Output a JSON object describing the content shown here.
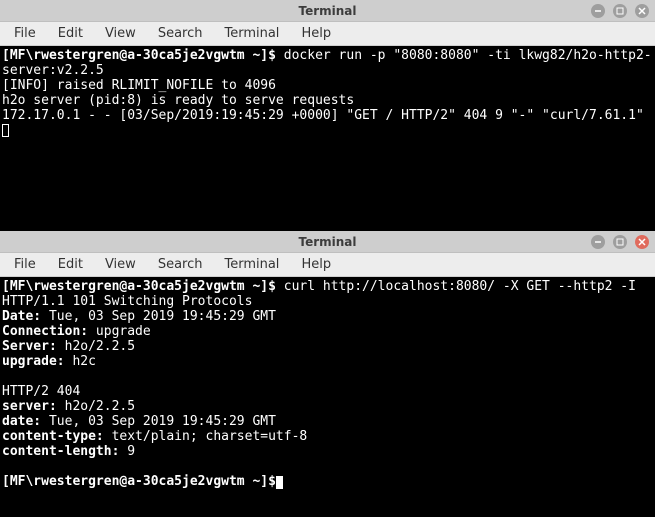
{
  "window1": {
    "title": "Terminal",
    "menu": [
      "File",
      "Edit",
      "View",
      "Search",
      "Terminal",
      "Help"
    ],
    "prompt": "[MF\\rwestergren@a-30ca5je2vgwtm ~]$",
    "cmd": " docker run -p \"8080:8080\" -ti lkwg82/h2o-http2-server:v2.2.5",
    "lines": [
      "[INFO] raised RLIMIT_NOFILE to 4096",
      "h2o server (pid:8) is ready to serve requests",
      "172.17.0.1 - - [03/Sep/2019:19:45:29 +0000] \"GET / HTTP/2\" 404 9 \"-\" \"curl/7.61.1\""
    ]
  },
  "window2": {
    "title": "Terminal",
    "menu": [
      "File",
      "Edit",
      "View",
      "Search",
      "Terminal",
      "Help"
    ],
    "prompt": "[MF\\rwestergren@a-30ca5je2vgwtm ~]$",
    "cmd": " curl http://localhost:8080/ -X GET --http2 -I",
    "line_status": "HTTP/1.1 101 Switching Protocols",
    "hdrs1": [
      {
        "k": "Date:",
        "v": " Tue, 03 Sep 2019 19:45:29 GMT"
      },
      {
        "k": "Connection:",
        "v": " upgrade"
      },
      {
        "k": "Server:",
        "v": " h2o/2.2.5"
      },
      {
        "k": "upgrade:",
        "v": " h2c"
      }
    ],
    "line_status2": "HTTP/2 404",
    "hdrs2": [
      {
        "k": "server:",
        "v": " h2o/2.2.5"
      },
      {
        "k": "date:",
        "v": " Tue, 03 Sep 2019 19:45:29 GMT"
      },
      {
        "k": "content-type:",
        "v": " text/plain; charset=utf-8"
      },
      {
        "k": "content-length:",
        "v": " 9"
      }
    ],
    "prompt2": "[MF\\rwestergren@a-30ca5je2vgwtm ~]$"
  }
}
